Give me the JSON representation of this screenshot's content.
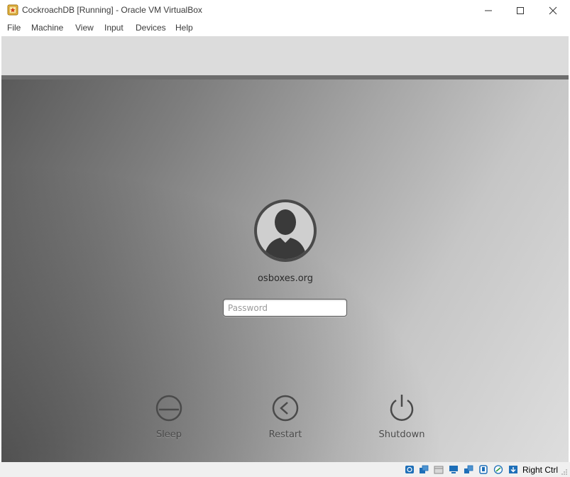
{
  "window": {
    "title": "CockroachDB [Running] - Oracle VM VirtualBox",
    "app_icon": "virtualbox-icon",
    "controls": [
      "minimize-icon",
      "maximize-icon",
      "close-icon"
    ]
  },
  "menubar": {
    "items": [
      {
        "label": "File"
      },
      {
        "label": "Machine"
      },
      {
        "label": "View"
      },
      {
        "label": "Input"
      },
      {
        "label": "Devices"
      },
      {
        "label": "Help"
      }
    ]
  },
  "login": {
    "avatar_icon": "user-avatar-icon",
    "username": "osboxes.org",
    "password_placeholder": "Password",
    "power_actions": [
      {
        "label": "Sleep",
        "icon": "sleep-icon"
      },
      {
        "label": "Restart",
        "icon": "restart-icon"
      },
      {
        "label": "Shutdown",
        "icon": "power-icon"
      }
    ]
  },
  "statusbar": {
    "icons": [
      "hard-disk-icon",
      "optical-drive-icon",
      "floppy-icon",
      "display-icon",
      "network-icon",
      "usb-icon",
      "shared-folders-icon",
      "mouse-integration-icon"
    ],
    "host_key": "Right Ctrl"
  },
  "colors": {
    "vm_border": "#6d6d6d",
    "toolbar_area": "#dcdcdc",
    "accent_blue": "#1e6fb8"
  }
}
